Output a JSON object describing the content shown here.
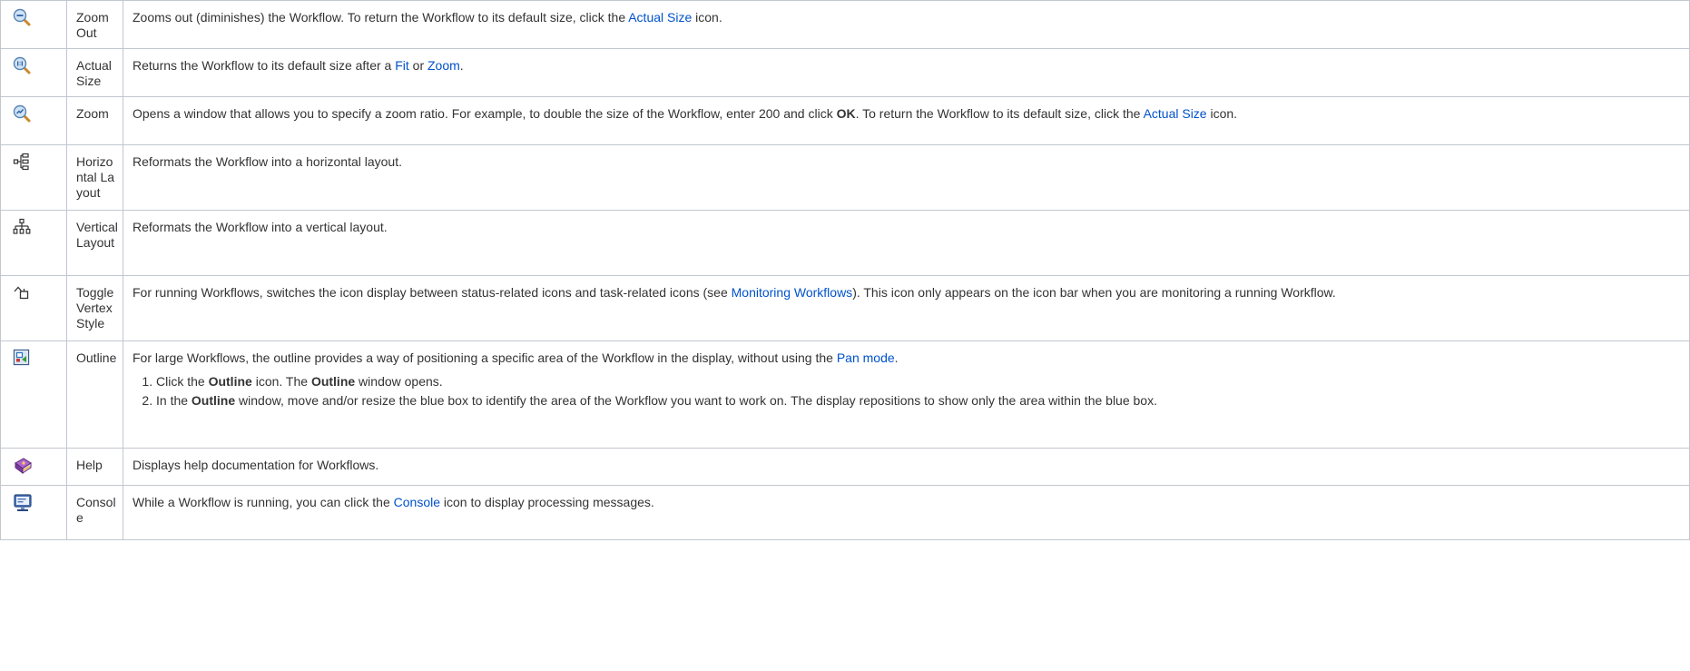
{
  "rows": [
    {
      "icon": "zoom-out-icon",
      "name": "Zoom Out",
      "desc": [
        {
          "t": "Zooms out (diminishes) the Workflow. To return the Workflow to its default size, click the "
        },
        {
          "link": "Actual Size"
        },
        {
          "t": " icon."
        }
      ]
    },
    {
      "icon": "actual-size-icon",
      "name": "Actual Size",
      "desc": [
        {
          "t": "Returns the Workflow to its default size after a "
        },
        {
          "link": "Fit"
        },
        {
          "t": " or "
        },
        {
          "link": "Zoom"
        },
        {
          "t": "."
        }
      ]
    },
    {
      "icon": "zoom-icon",
      "name": "Zoom",
      "desc": [
        {
          "t": "Opens a window that allows you to specify a zoom ratio. For example, to double the size of the Workflow, enter 200 and click "
        },
        {
          "b": "OK"
        },
        {
          "t": ". To return the Workflow to its default size, click the "
        },
        {
          "link": "Actual Size"
        },
        {
          "t": " icon."
        }
      ]
    },
    {
      "icon": "horizontal-layout-icon",
      "name": "Horizontal Layout",
      "desc": [
        {
          "t": "Reformats the Workflow into a horizontal layout."
        }
      ]
    },
    {
      "icon": "vertical-layout-icon",
      "name": "Vertical Layout",
      "desc": [
        {
          "t": "Reformats the Workflow into a vertical layout."
        }
      ]
    },
    {
      "icon": "toggle-vertex-style-icon",
      "name": "Toggle Vertex Style",
      "desc": [
        {
          "t": "For running Workflows, switches the icon display between status-related icons and task-related icons (see "
        },
        {
          "link": "Monitoring Workflows"
        },
        {
          "t": "). This icon only appears on the icon bar when you are monitoring a running Workflow."
        }
      ]
    },
    {
      "icon": "outline-icon",
      "name": "Outline",
      "desc": [
        {
          "t": "For large Workflows, the outline provides a way of positioning a specific area of the Workflow in the display, without using the "
        },
        {
          "link": "Pan mode"
        },
        {
          "t": "."
        }
      ],
      "steps": [
        [
          {
            "t": "Click the "
          },
          {
            "b": "Outline"
          },
          {
            "t": " icon. The "
          },
          {
            "b": "Outline"
          },
          {
            "t": " window opens."
          }
        ],
        [
          {
            "t": "In the "
          },
          {
            "b": "Outline"
          },
          {
            "t": " window, move and/or resize the blue box to identify the area of the Workflow you want to work on. The display repositions to show only the area within the blue box."
          }
        ]
      ]
    },
    {
      "icon": "help-book-icon",
      "name": "Help",
      "desc": [
        {
          "t": "Displays help documentation for Workflows."
        }
      ]
    },
    {
      "icon": "console-icon",
      "name": "Console",
      "desc": [
        {
          "t": "While a Workflow is running, you can click the "
        },
        {
          "link": "Console"
        },
        {
          "t": " icon to display processing messages."
        }
      ]
    }
  ],
  "colors": {
    "link": "#0052cc",
    "border": "#c1c7d0",
    "text": "#333333"
  }
}
